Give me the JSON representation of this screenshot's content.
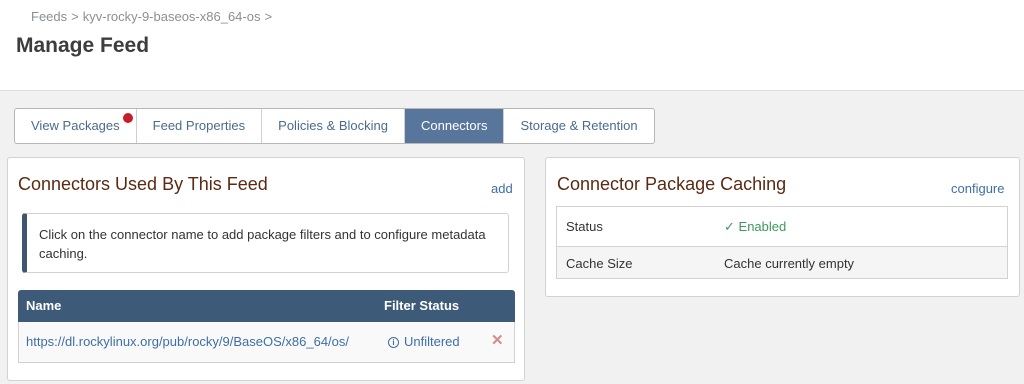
{
  "breadcrumb": {
    "feeds": "Feeds",
    "feed": "kyv-rocky-9-baseos-x86_64-os",
    "separator": ">"
  },
  "page_title": "Manage Feed",
  "tabs": [
    {
      "label": "View Packages"
    },
    {
      "label": "Feed Properties"
    },
    {
      "label": "Policies & Blocking"
    },
    {
      "label": "Connectors"
    },
    {
      "label": "Storage & Retention"
    }
  ],
  "active_tab": "Connectors",
  "connectors_panel": {
    "title": "Connectors Used By This Feed",
    "add_label": "add",
    "info_text": "Click on the connector name to add package filters and to configure metadata caching.",
    "columns": {
      "name": "Name",
      "filter_status": "Filter Status"
    },
    "rows": [
      {
        "url": "https://dl.rockylinux.org/pub/rocky/9/BaseOS/x86_64/os/",
        "filter": "Unfiltered",
        "remove": "✕"
      }
    ]
  },
  "caching_panel": {
    "title": "Connector Package Caching",
    "configure_label": "configure",
    "status_label": "Status",
    "status_icon": "check-icon",
    "status_value": "Enabled",
    "size_label": "Cache Size",
    "size_value": "Cache currently empty"
  },
  "colors": {
    "active_tab_bg": "#58769b",
    "table_header_bg": "#3d5a78",
    "panel_title": "#5a2a12",
    "link": "#3d6fa6",
    "enabled": "#3c9a5f",
    "badge_dot": "#c41e2b"
  }
}
